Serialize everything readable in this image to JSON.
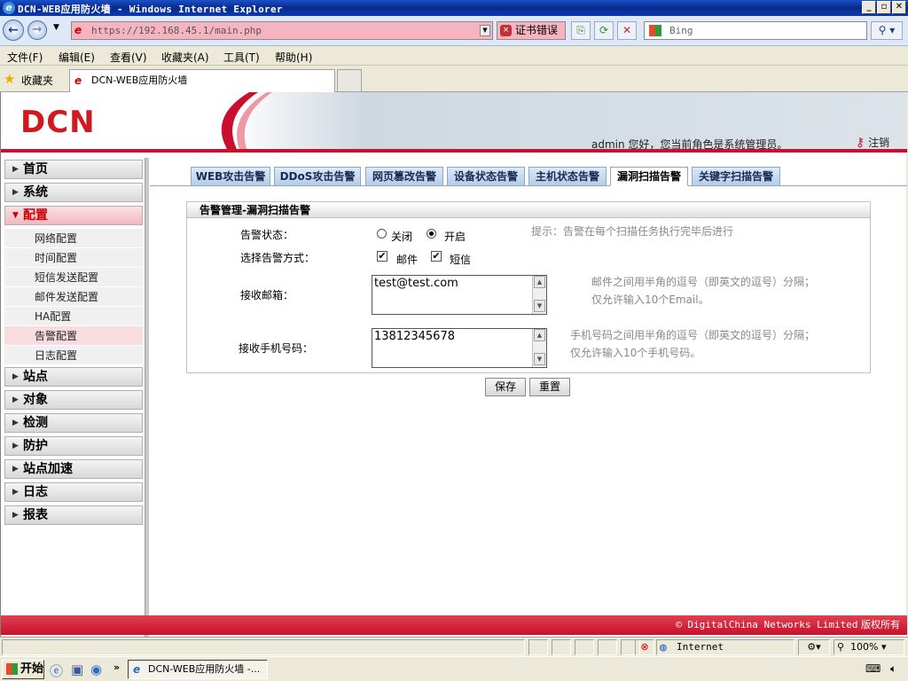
{
  "window": {
    "title": "DCN-WEB应用防火墙 - Windows Internet Explorer"
  },
  "browser": {
    "url": "https://192.168.45.1/main.php",
    "cert_error": "证书错误",
    "search_placeholder": "Bing",
    "menu": [
      "文件(F)",
      "编辑(E)",
      "查看(V)",
      "收藏夹(A)",
      "工具(T)",
      "帮助(H)"
    ],
    "favorites_label": "收藏夹",
    "tab_title": "DCN-WEB应用防火墙",
    "status_zone": "Internet",
    "zoom": "100%"
  },
  "header": {
    "logo": "DCN",
    "greeting": "admin 您好，您当前角色是系统管理员。",
    "logout": "注销"
  },
  "sidebar": {
    "sections": [
      {
        "label": "首页"
      },
      {
        "label": "系统"
      },
      {
        "label": "配置"
      },
      {
        "label": "站点"
      },
      {
        "label": "对象"
      },
      {
        "label": "检测"
      },
      {
        "label": "防护"
      },
      {
        "label": "站点加速"
      },
      {
        "label": "日志"
      },
      {
        "label": "报表"
      }
    ],
    "config_sub": [
      "网络配置",
      "时间配置",
      "短信发送配置",
      "邮件发送配置",
      "HA配置",
      "告警配置",
      "日志配置"
    ]
  },
  "tabs": [
    "WEB攻击告警",
    "DDoS攻击告警",
    "网页篡改告警",
    "设备状态告警",
    "主机状态告警",
    "漏洞扫描告警",
    "关键字扫描告警"
  ],
  "panel": {
    "title": "告警管理-漏洞扫描告警",
    "status_label": "告警状态：",
    "status_off": "关闭",
    "status_on": "开启",
    "status_hint": "提示：告警在每个扫描任务执行完毕后进行",
    "method_label": "选择告警方式：",
    "method_mail": "邮件",
    "method_sms": "短信",
    "email_label": "接收邮箱：",
    "email_value": "test@test.com",
    "email_hint1": "邮件之间用半角的逗号（即英文的逗号）分隔；",
    "email_hint2": "仅允许输入10个Email。",
    "phone_label": "接收手机号码：",
    "phone_value": "13812345678",
    "phone_hint1": "手机号码之间用半角的逗号（即英文的逗号）分隔；",
    "phone_hint2": "仅允许输入10个手机号码。",
    "save": "保存",
    "reset": "重置"
  },
  "footer": {
    "copyright_en": "© DigitalChina Networks Limited",
    "copyright_cn": "版权所有"
  },
  "taskbar": {
    "start": "开始",
    "task": "DCN-WEB应用防火墙 -..."
  }
}
